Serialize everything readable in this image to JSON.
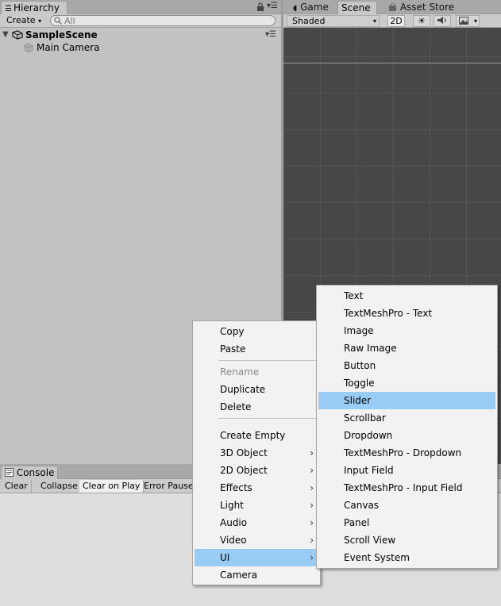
{
  "hierarchy": {
    "tab_label": "Hierarchy",
    "create_label": "Create",
    "search_placeholder": "All",
    "scene_name": "SampleScene",
    "items": [
      {
        "label": "Main Camera"
      }
    ]
  },
  "scene": {
    "tabs": [
      {
        "label": "Game",
        "icon": "pacman-icon"
      },
      {
        "label": "Scene"
      },
      {
        "label": "Asset Store",
        "icon": "shopping-bag-icon"
      }
    ],
    "shading_mode": "Shaded",
    "mode_2d": "2D"
  },
  "console": {
    "tab_label": "Console",
    "buttons": [
      "Clear",
      "Collapse",
      "Clear on Play",
      "Error Pause"
    ]
  },
  "context_menu": {
    "items": [
      {
        "label": "Copy"
      },
      {
        "label": "Paste"
      },
      {
        "label": "Rename",
        "disabled": true
      },
      {
        "label": "Duplicate"
      },
      {
        "label": "Delete"
      },
      {
        "label": "Create Empty"
      },
      {
        "label": "3D Object",
        "submenu": true
      },
      {
        "label": "2D Object",
        "submenu": true
      },
      {
        "label": "Effects",
        "submenu": true
      },
      {
        "label": "Light",
        "submenu": true
      },
      {
        "label": "Audio",
        "submenu": true
      },
      {
        "label": "Video",
        "submenu": true
      },
      {
        "label": "UI",
        "submenu": true,
        "highlighted": true
      },
      {
        "label": "Camera"
      }
    ]
  },
  "ui_submenu": {
    "items": [
      {
        "label": "Text"
      },
      {
        "label": "TextMeshPro - Text"
      },
      {
        "label": "Image"
      },
      {
        "label": "Raw Image"
      },
      {
        "label": "Button"
      },
      {
        "label": "Toggle"
      },
      {
        "label": "Slider",
        "highlighted": true
      },
      {
        "label": "Scrollbar"
      },
      {
        "label": "Dropdown"
      },
      {
        "label": "TextMeshPro - Dropdown"
      },
      {
        "label": "Input Field"
      },
      {
        "label": "TextMeshPro - Input Field"
      },
      {
        "label": "Canvas"
      },
      {
        "label": "Panel"
      },
      {
        "label": "Scroll View"
      },
      {
        "label": "Event System"
      }
    ]
  },
  "colors": {
    "menu_highlight": "#99ccf5",
    "scene_background": "#474747",
    "panel_background": "#c2c2c2"
  }
}
